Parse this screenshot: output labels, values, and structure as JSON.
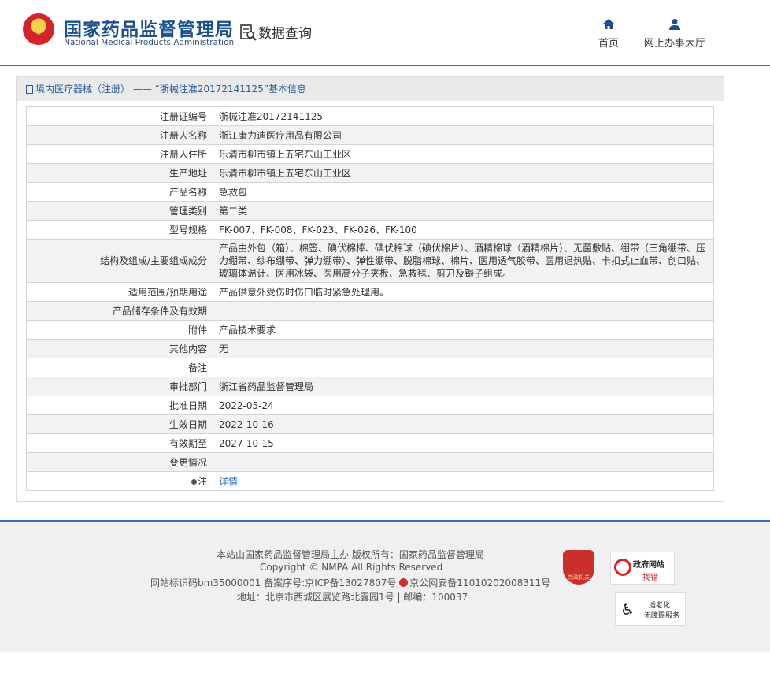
{
  "header": {
    "title_cn": "国家药品监督管理局",
    "title_en": "National Medical Products Administration",
    "data_query": "数据查询",
    "nav_home": "首页",
    "nav_office": "网上办事大厅"
  },
  "panel": {
    "heading": "境内医疗器械（注册） —— “浙械注准20172141125”基本信息",
    "rows": [
      {
        "key": "注册证编号",
        "value": "浙械注准20172141125"
      },
      {
        "key": "注册人名称",
        "value": "浙江康力迪医疗用品有限公司"
      },
      {
        "key": "注册人住所",
        "value": "乐清市柳市镇上五宅东山工业区"
      },
      {
        "key": "生产地址",
        "value": "乐清市柳市镇上五宅东山工业区"
      },
      {
        "key": "产品名称",
        "value": "急救包"
      },
      {
        "key": "管理类别",
        "value": "第二类"
      },
      {
        "key": "型号规格",
        "value": "FK-007、FK-008、FK-023、FK-026、FK-100"
      },
      {
        "key": "结构及组成/主要组成成分",
        "value": "产品由外包（箱）、棉签、碘伏棉棒、碘伏棉球（碘伏棉片）、酒精棉球（酒精棉片）、无菌敷贴、绷带（三角绷带、压力绷带、纱布绷带、弹力绷带）、弹性绷带、脱脂棉球、棉片、医用透气胶带、医用退热贴、卡扣式止血带、创口贴、玻璃体温计、医用冰袋、医用高分子夹板、急救毯、剪刀及镊子组成。"
      },
      {
        "key": "适用范围/预期用途",
        "value": "产品供意外受伤时伤口临时紧急处理用。"
      },
      {
        "key": "产品储存条件及有效期",
        "value": ""
      },
      {
        "key": "附件",
        "value": "产品技术要求"
      },
      {
        "key": "其他内容",
        "value": "无"
      },
      {
        "key": "备注",
        "value": ""
      },
      {
        "key": "审批部门",
        "value": "浙江省药品监督管理局"
      },
      {
        "key": "批准日期",
        "value": "2022-05-24"
      },
      {
        "key": "生效日期",
        "value": "2022-10-16"
      },
      {
        "key": "有效期至",
        "value": "2027-10-15"
      },
      {
        "key": "变更情况",
        "value": ""
      }
    ],
    "note_key": "注",
    "note_link": "详情"
  },
  "footer": {
    "line1": "本站由国家药品监督管理局主办 版权所有：国家药品监督管理局",
    "line2": "Copyright © NMPA All Rights Reserved",
    "line3a": "网站标识码bm35000001    备案序号:京ICP备13027807号 ",
    "line3b": "京公网安备11010202008311号",
    "line4": "地址：北京市西城区展览路北露园1号 | 邮编：100037",
    "badge_party": "党政机关",
    "badge_error_1": "政府网站",
    "badge_error_2": "找错",
    "badge_elder_1": "适老化",
    "badge_elder_2": "无障碍服务"
  }
}
